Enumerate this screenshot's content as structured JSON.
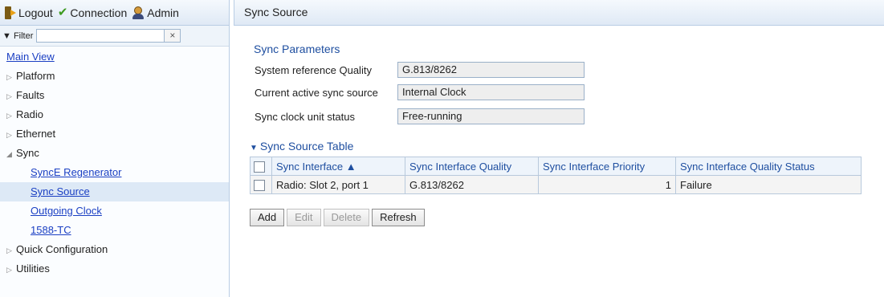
{
  "topbar": {
    "logout": "Logout",
    "connection": "Connection",
    "admin": "Admin",
    "icons": [
      "logout-icon",
      "connection-check-icon",
      "admin-user-icon"
    ]
  },
  "filter": {
    "label": "▼ Filter",
    "value": "",
    "clear": "×"
  },
  "nav": {
    "main_view": "Main View",
    "platform": "Platform",
    "faults": "Faults",
    "radio": "Radio",
    "ethernet": "Ethernet",
    "sync": "Sync",
    "synce_regenerator": "SyncE Regenerator",
    "sync_source": "Sync Source",
    "outgoing_clock": "Outgoing Clock",
    "tc_1588": "1588-TC",
    "quick_configuration": "Quick Configuration",
    "utilities": "Utilities",
    "collapsed_marker": "▷",
    "expanded_marker": "◢"
  },
  "page": {
    "title": "Sync Source"
  },
  "params": {
    "section_title": "Sync Parameters",
    "system_reference_quality": {
      "label": "System reference Quality",
      "value": "G.813/8262"
    },
    "current_active_sync_source": {
      "label": "Current active sync source",
      "value": "Internal Clock"
    },
    "sync_clock_unit_status": {
      "label": "Sync clock unit status",
      "value": "Free-running"
    }
  },
  "table": {
    "title": "Sync Source Table",
    "caret": "▼",
    "headers": [
      "Sync Interface ▲",
      "Sync Interface Quality",
      "Sync Interface Priority",
      "Sync Interface Quality Status"
    ],
    "rows": [
      {
        "interface": "Radio: Slot 2, port 1",
        "quality": "G.813/8262",
        "priority": "1",
        "status": "Failure"
      }
    ]
  },
  "buttons": {
    "add": "Add",
    "edit": "Edit",
    "delete": "Delete",
    "refresh": "Refresh"
  },
  "colors": {
    "accent": "#1f4fa0",
    "link": "#1a3fc3",
    "selected_bg": "#dde9f6"
  }
}
